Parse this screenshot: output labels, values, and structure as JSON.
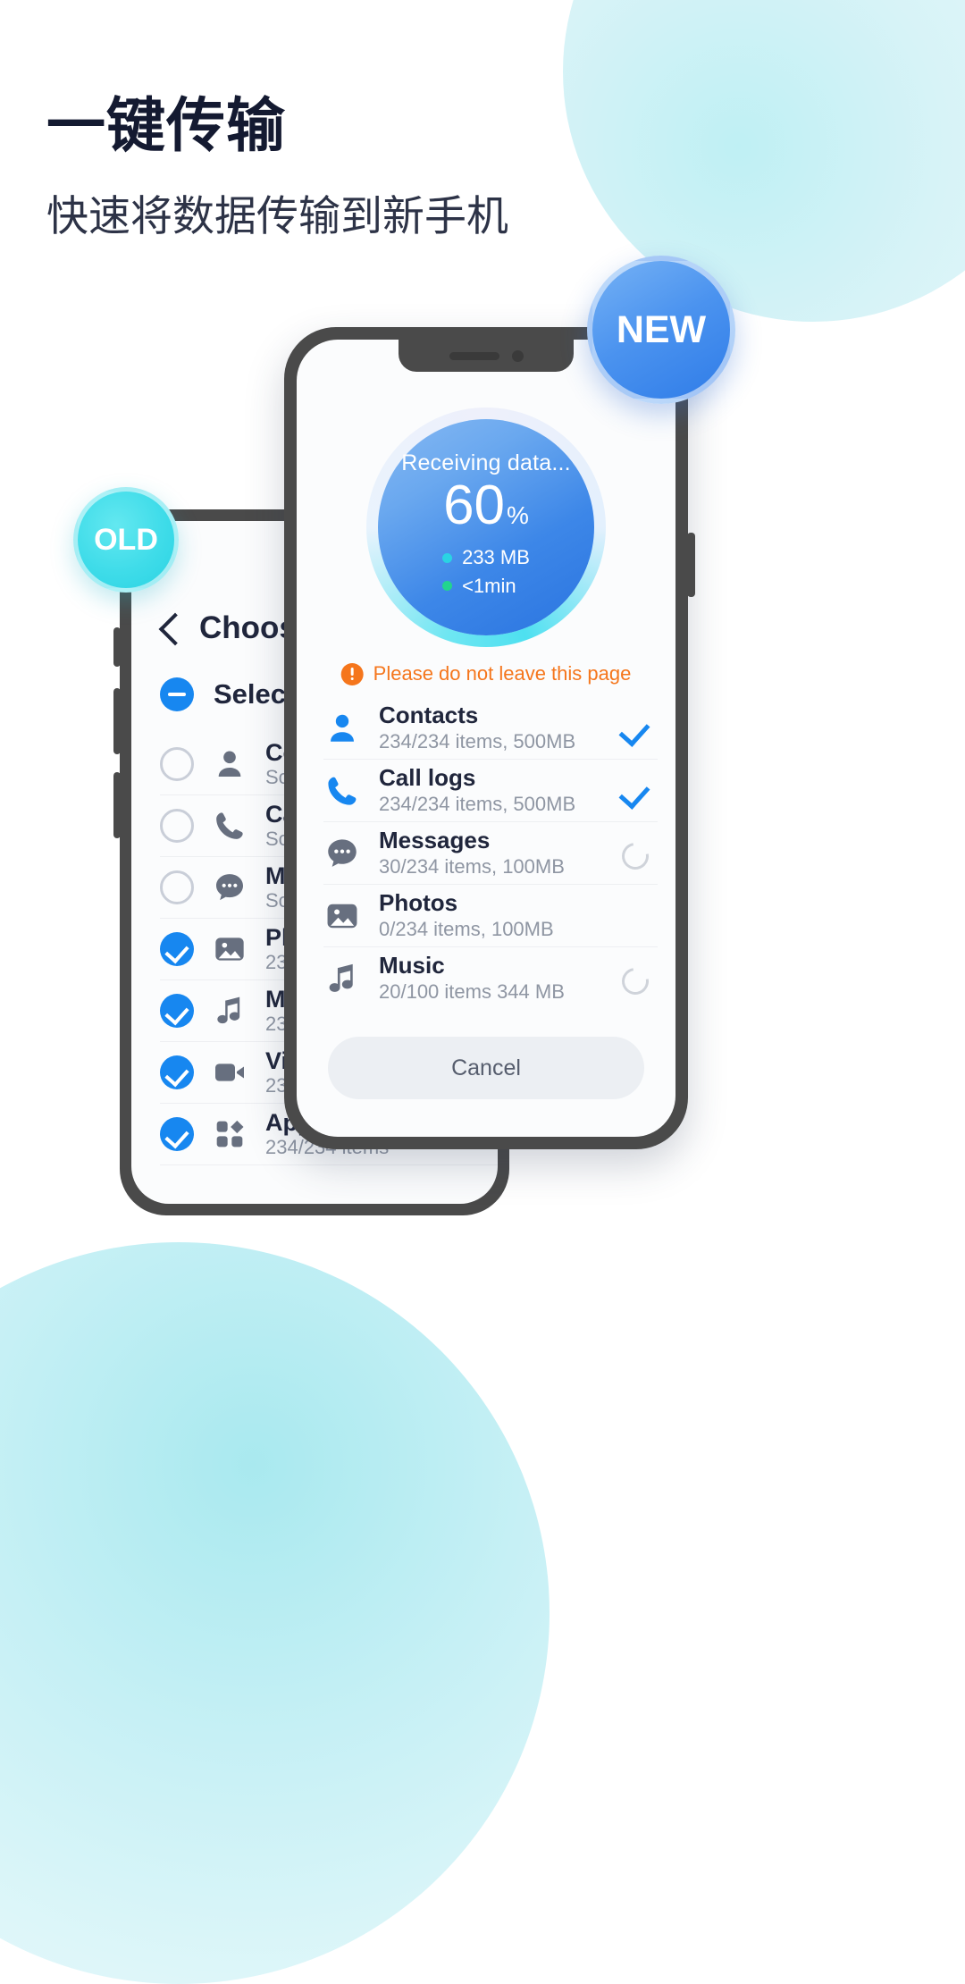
{
  "header": {
    "title": "一键传输",
    "subtitle": "快速将数据传输到新手机"
  },
  "badges": {
    "old": "OLD",
    "new": "NEW"
  },
  "old_phone": {
    "screen_title": "Choose items",
    "back_icon": "chevron-left-icon",
    "select_all": {
      "label": "Select all",
      "state": "indeterminate"
    },
    "rows": [
      {
        "name": "Contacts",
        "sub": "Scanning...",
        "icon": "person-icon",
        "checked": false
      },
      {
        "name": "Call logs",
        "sub": "Scanning...",
        "icon": "phone-icon",
        "checked": false
      },
      {
        "name": "Messages",
        "sub": "Scanning...",
        "icon": "message-icon",
        "checked": false
      },
      {
        "name": "Photos",
        "sub": "234/234 items",
        "icon": "photo-icon",
        "checked": true
      },
      {
        "name": "Music",
        "sub": "234/234 items",
        "icon": "music-icon",
        "checked": true
      },
      {
        "name": "Video",
        "sub": "234/234 items",
        "icon": "video-icon",
        "checked": true
      },
      {
        "name": "App",
        "sub": "234/234 items",
        "icon": "apps-icon",
        "checked": true
      }
    ]
  },
  "new_phone": {
    "progress": {
      "title": "Receiving data...",
      "percent": "60",
      "percent_symbol": "%",
      "size": "233 MB",
      "time": "<1min",
      "size_dot_color": "#2ad3e3",
      "time_dot_color": "#22d48e"
    },
    "warning": {
      "icon": "exclamation-circle-icon",
      "text": "Please do not leave this page",
      "color": "#f5761c"
    },
    "rows": [
      {
        "name": "Contacts",
        "sub": "234/234 items, 500MB",
        "icon": "person-icon",
        "icon_tone": "blue",
        "status": "done"
      },
      {
        "name": "Call logs",
        "sub": "234/234 items, 500MB",
        "icon": "phone-icon",
        "icon_tone": "blue",
        "status": "done"
      },
      {
        "name": "Messages",
        "sub": "30/234 items, 100MB",
        "icon": "message-icon",
        "icon_tone": "gray",
        "status": "loading"
      },
      {
        "name": "Photos",
        "sub": "0/234 items, 100MB",
        "icon": "photo-icon",
        "icon_tone": "gray",
        "status": "none"
      },
      {
        "name": "Music",
        "sub": "20/100 items  344 MB",
        "icon": "music-icon",
        "icon_tone": "gray",
        "status": "loading"
      }
    ],
    "cancel_label": "Cancel"
  }
}
